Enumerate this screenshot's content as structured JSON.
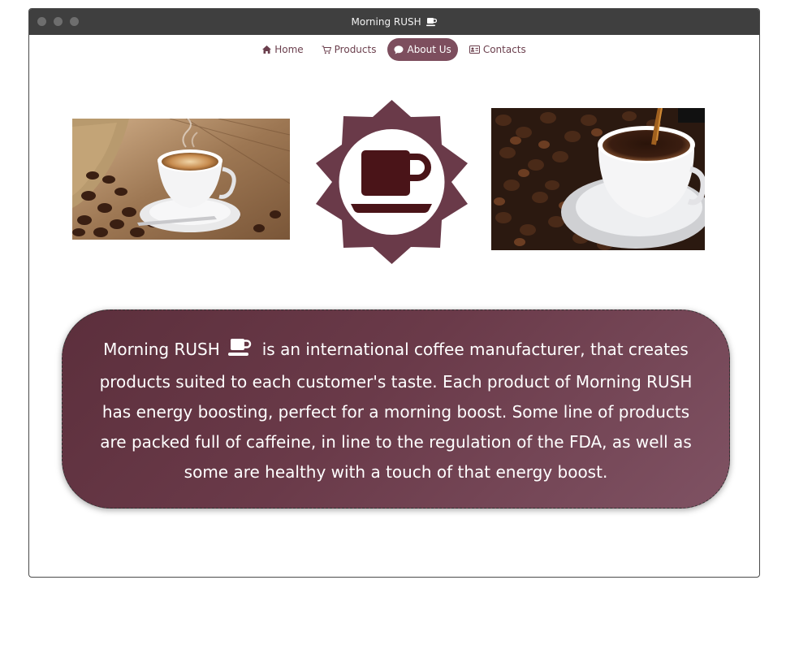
{
  "window": {
    "title": "Morning RUSH"
  },
  "nav": {
    "items": [
      {
        "label": "Home",
        "icon": "home-icon",
        "active": false
      },
      {
        "label": "Products",
        "icon": "cart-icon",
        "active": false
      },
      {
        "label": "About Us",
        "icon": "speech-bubble-icon",
        "active": true
      },
      {
        "label": "Contacts",
        "icon": "id-card-icon",
        "active": false
      }
    ]
  },
  "images": {
    "left": "coffee-cup-with-beans-photo",
    "center": "coffee-cup-sun-logo",
    "right": "coffee-pouring-cup-photo"
  },
  "about": {
    "brand": "Morning RUSH",
    "text": "is an international coffee manufacturer, that creates products suited to each customer's taste. Each product of Morning RUSH has energy boosting, perfect for a morning boost. Some line of products are packed full of caffeine, in line to the regulation of the FDA, as well as some are healthy with a touch of that energy boost."
  },
  "colors": {
    "accent": "#7d4e5e",
    "card": "#6a3a49",
    "titlebar": "#3f3f3f",
    "logo_dark": "#6a3a49",
    "cup_dark": "#4a1418"
  }
}
